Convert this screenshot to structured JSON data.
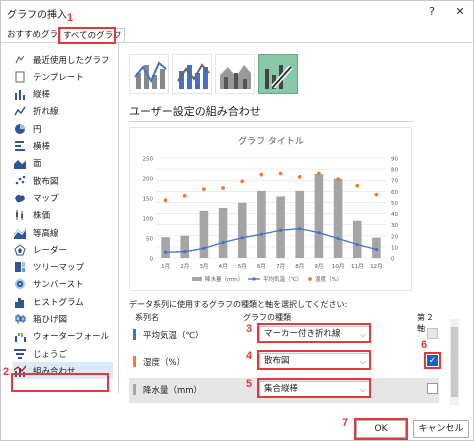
{
  "window": {
    "title": "グラフの挿入",
    "help_glyph": "?",
    "close_glyph": "✕"
  },
  "tabs": [
    {
      "label": "おすすめグラフ",
      "active": false
    },
    {
      "label": "すべてのグラフ",
      "active": true
    }
  ],
  "sidebar": {
    "items": [
      {
        "label": "最近使用したグラフ",
        "icon": "recent-icon"
      },
      {
        "label": "テンプレート",
        "icon": "template-icon"
      },
      {
        "label": "縦棒",
        "icon": "column-chart-icon"
      },
      {
        "label": "折れ線",
        "icon": "line-chart-icon"
      },
      {
        "label": "円",
        "icon": "pie-chart-icon"
      },
      {
        "label": "横棒",
        "icon": "bar-chart-icon"
      },
      {
        "label": "面",
        "icon": "area-chart-icon"
      },
      {
        "label": "散布図",
        "icon": "scatter-chart-icon"
      },
      {
        "label": "マップ",
        "icon": "map-chart-icon"
      },
      {
        "label": "株価",
        "icon": "stock-chart-icon"
      },
      {
        "label": "等高線",
        "icon": "surface-chart-icon"
      },
      {
        "label": "レーダー",
        "icon": "radar-chart-icon"
      },
      {
        "label": "ツリーマップ",
        "icon": "treemap-chart-icon"
      },
      {
        "label": "サンバースト",
        "icon": "sunburst-chart-icon"
      },
      {
        "label": "ヒストグラム",
        "icon": "histogram-chart-icon"
      },
      {
        "label": "箱ひげ図",
        "icon": "box-whisker-chart-icon"
      },
      {
        "label": "ウォーターフォール",
        "icon": "waterfall-chart-icon"
      },
      {
        "label": "じょうご",
        "icon": "funnel-chart-icon"
      },
      {
        "label": "組み合わせ",
        "icon": "combo-chart-icon",
        "selected": true
      }
    ]
  },
  "section_title": "ユーザー設定の組み合わせ",
  "chart_data": {
    "type": "bar",
    "title": "グラフ タイトル",
    "categories": [
      "1月",
      "2月",
      "3月",
      "4月",
      "5月",
      "6月",
      "7月",
      "8月",
      "9月",
      "10月",
      "11月",
      "12月"
    ],
    "series": [
      {
        "name": "降水量（mm）",
        "kind": "bar",
        "axis": "primary",
        "color": "#a5a5a5",
        "values": [
          52,
          56,
          118,
          125,
          138,
          168,
          154,
          168,
          210,
          198,
          93,
          51
        ]
      },
      {
        "name": "平均気温（℃）",
        "kind": "line",
        "axis": "secondary",
        "color": "#4472c4",
        "values": [
          5.2,
          5.7,
          8.7,
          13.9,
          18.2,
          21.4,
          25.0,
          26.4,
          22.8,
          17.5,
          12.1,
          7.6
        ]
      },
      {
        "name": "湿度（%）",
        "kind": "scatter",
        "axis": "secondary",
        "color": "#ed7d31",
        "values": [
          52,
          56,
          62,
          63,
          69,
          75,
          76,
          73,
          76,
          71,
          65,
          57
        ]
      }
    ],
    "ylim": [
      0,
      250
    ],
    "yticks": [
      0,
      50,
      100,
      150,
      200,
      250
    ],
    "y2lim": [
      0,
      90
    ],
    "y2ticks": [
      0,
      10,
      20,
      30,
      40,
      50,
      60,
      70,
      80,
      90
    ],
    "grid": true,
    "legend": "bottom"
  },
  "series_desc": "データ系列に使用するグラフの種類と軸を選択してください:",
  "table": {
    "headers": {
      "name": "系列名",
      "type": "グラフの種類",
      "axis": "第 2 軸"
    },
    "rows": [
      {
        "name": "平均気温（℃）",
        "type": "マーカー付き折れ線",
        "color": "#4472c4",
        "secondary_axis": false,
        "checkbox_enabled": false
      },
      {
        "name": "湿度（%）",
        "type": "散布図",
        "color": "#ed7d31",
        "secondary_axis": true,
        "checkbox_enabled": true
      },
      {
        "name": "降水量（mm）",
        "type": "集合縦棒",
        "color": "#a5a5a5",
        "secondary_axis": false,
        "checkbox_enabled": true
      }
    ]
  },
  "buttons": {
    "ok": "OK",
    "cancel": "キャンセル"
  },
  "step_labels": [
    "1",
    "2",
    "3",
    "4",
    "5",
    "6",
    "7"
  ],
  "accent_color": "#e03a3a"
}
